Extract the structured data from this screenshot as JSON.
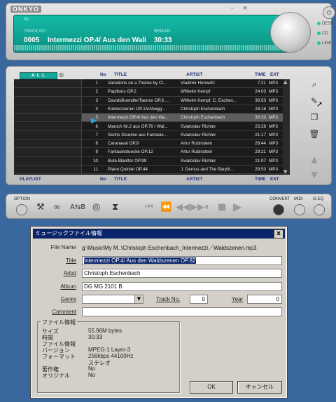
{
  "player": {
    "brand": "ONKYO",
    "display": {
      "label_all": "All",
      "label_track": "TRACK NO",
      "track_no": "0005",
      "track_title": "Intermezzi OP.4/ Aus den Wali",
      "label_remain": "REMAIN",
      "remain": "30:33"
    },
    "modes": [
      "DESK",
      "CD",
      "LINE"
    ]
  },
  "playlist": {
    "tab_label": "A L L",
    "headers": {
      "no": "No",
      "title": "TITLE",
      "artist": "ARTIST",
      "time": "TIME",
      "ext": "EXT"
    },
    "footer": {
      "playlist": "PLAYLIST",
      "no": "No",
      "title": "TITLE",
      "artist": "ARTIST",
      "time": "TIME",
      "ext": "EXT"
    },
    "rows": [
      {
        "no": "1",
        "title": "Variations on a Theme by Cl...",
        "artist": "Vladimir Horowitz",
        "time": "7:21",
        "ext": "MP3"
      },
      {
        "no": "2",
        "title": "Papillons OP.2",
        "artist": "Wilhelm Kempf",
        "time": "24:03",
        "ext": "MP3"
      },
      {
        "no": "3",
        "title": "DavidsBuendlerTaenze OP.6 ...",
        "artist": "Wilhelm Kempf, C. Eschen...",
        "time": "36:53",
        "ext": "MP3"
      },
      {
        "no": "4",
        "title": "Kinderszenen OP.15/Abegg ...",
        "artist": "Christoph Eschenbach",
        "time": "28:16",
        "ext": "MP3"
      },
      {
        "no": "5",
        "title": "Intermezzi OP.4/ Aus den Wa...",
        "artist": "Christoph Eschenbach",
        "time": "30:33",
        "ext": "MP3"
      },
      {
        "no": "6",
        "title": "Marsch Nr.2 aus OP.76 / Wal...",
        "artist": "Sviatoslav Richter",
        "time": "23:28",
        "ext": "MP3"
      },
      {
        "no": "7",
        "title": "Sechs Stuecke aus Fantasie...",
        "artist": "Sviatoslav Richter",
        "time": "21:17",
        "ext": "MP3"
      },
      {
        "no": "8",
        "title": "Caranaval OP.9",
        "artist": "Artur Rubinstein",
        "time": "28:44",
        "ext": "MP3"
      },
      {
        "no": "9",
        "title": "Fantasiestuecke OP.12",
        "artist": "Artur Rubinstein",
        "time": "29:21",
        "ext": "MP3"
      },
      {
        "no": "10",
        "title": "Bute Blaetter OP.99",
        "artist": "Sviatoslav Richter",
        "time": "21:07",
        "ext": "MP3"
      },
      {
        "no": "11",
        "title": "Piano Quintet OP.44",
        "artist": "J. Demus and The Barylli...",
        "time": "29:53",
        "ext": "MP3"
      }
    ]
  },
  "options": {
    "option_label": "OPTION",
    "convert_label": "CONVERT",
    "midi_label": "MIDI",
    "geq_label": "G-EQ"
  },
  "dialog": {
    "title": "ミュージックファイル情報",
    "close": "x",
    "file_name_label": "File Name",
    "file_name": "g:\\Music\\My M..\\Christoph Eschenbach_Intermezzi／Waldszenen.mp3",
    "title_label": "Title",
    "title_value": "Intermezzi OP.4/ Aus den Waldszenen OP.82",
    "artist_label": "Artist",
    "artist_value": "Christoph Eschenbach",
    "album_label": "Album",
    "album_value": "DG MG 2101 B",
    "genre_label": "Genre",
    "genre_value": "",
    "track_label": "Track No.",
    "track_value": "0",
    "year_label": "Year",
    "year_value": "0",
    "comment_label": "Comment",
    "comment_value": "",
    "info_group": "ファイル情報",
    "info": [
      {
        "k": "サイズ",
        "v": "55.96M bytes"
      },
      {
        "k": "時間",
        "v": "30:33"
      },
      {
        "k": "ファイル情報",
        "v": ""
      },
      {
        "k": "バージョン",
        "v": "MPEG-1  Layer-3"
      },
      {
        "k": "フォーマット",
        "v": "256kbps  44100Hz"
      },
      {
        "k": "",
        "v": "ステレオ"
      },
      {
        "k": "著作権",
        "v": "No"
      },
      {
        "k": "オリジナル",
        "v": "No"
      }
    ],
    "ok_label": "OK",
    "cancel_label": "キャンセル"
  }
}
